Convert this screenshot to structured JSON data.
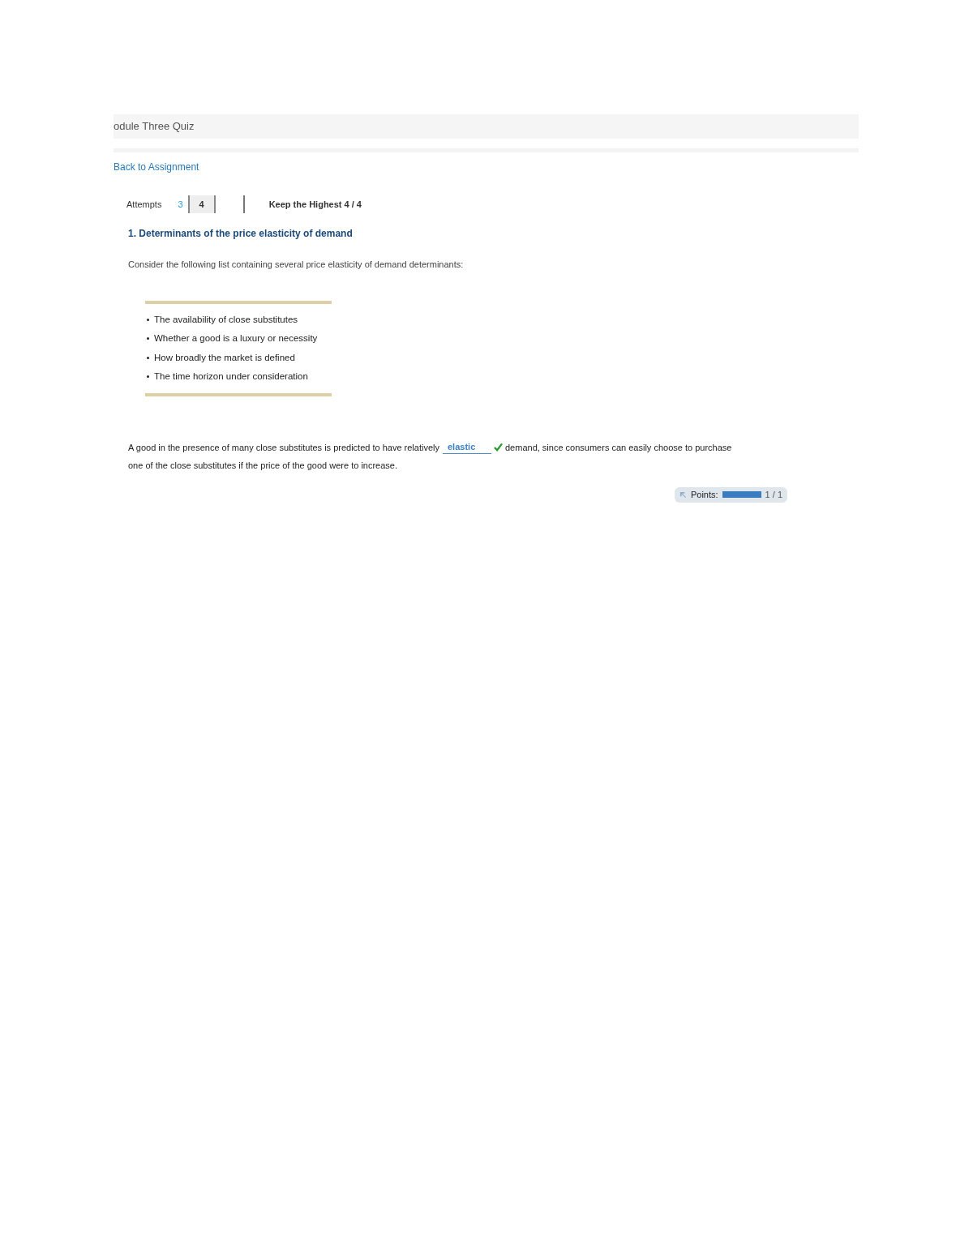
{
  "header": {
    "title": "odule Three Quiz"
  },
  "back_link": "Back to Assignment",
  "attempts": {
    "label": "Attempts",
    "tabs": [
      {
        "label": "3",
        "selected": false
      },
      {
        "label": "4",
        "selected": true
      }
    ],
    "keep": "Keep the Highest 4 / 4"
  },
  "question": {
    "heading": "1. Determinants of the price elasticity of demand",
    "intro": "Consider the following list containing several price elasticity of demand determinants:",
    "list": [
      "The availability of close substitutes",
      "Whether a good is a luxury or necessity",
      "How broadly the market is defined",
      "The time horizon under consideration"
    ],
    "sentence_before": "A good in the presence of many close substitutes is predicted to have relatively",
    "answer": {
      "value": "elastic",
      "correct": true
    },
    "sentence_after": "demand, since consumers can easily choose to purchase",
    "sentence_end": "one of the close substitutes if the price of the good were to increase."
  },
  "points": {
    "label": "Points:",
    "level": 1,
    "score": "1 / 1"
  }
}
